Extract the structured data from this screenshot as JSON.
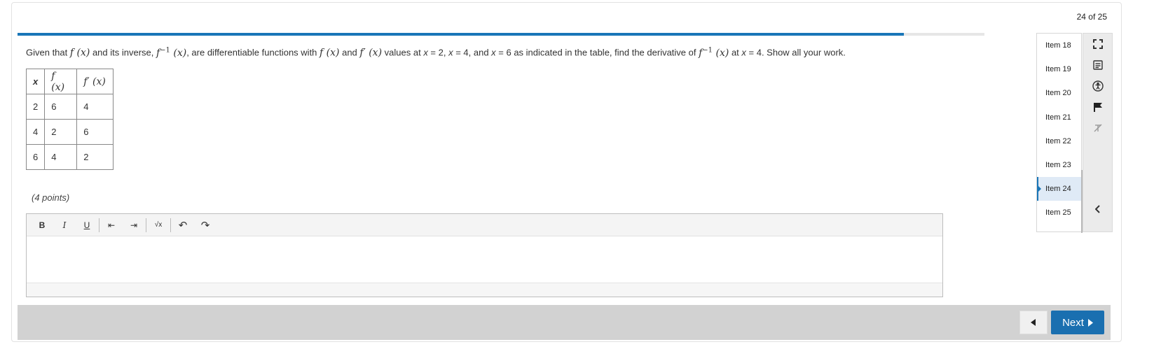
{
  "counter": "24 of 25",
  "progress": {
    "fraction": 0.917
  },
  "question": {
    "t1": "Given that ",
    "f": "f (x)",
    "t2": " and its inverse, ",
    "finv_base": "f",
    "finv_sup": "−1",
    "finv_arg": " (x)",
    "t3": ", are differentiable functions with ",
    "f2": "f (x)",
    "t4": " and ",
    "fp": "f′ (x)",
    "t5": " values at ",
    "x1": "x",
    "t6": " = 2, ",
    "x2": "x",
    "t7": " = 4, and ",
    "x3": "x",
    "t8": " = 6 as indicated in the table, find the derivative of ",
    "finv2_base": "f",
    "finv2_sup": "−1",
    "finv2_arg": " (x)",
    "t9": " at ",
    "x4": "x",
    "t10": " = 4. Show all your work."
  },
  "table": {
    "headers": [
      "x",
      "f (x)",
      "f′ (x)"
    ],
    "rows": [
      [
        "2",
        "6",
        "4"
      ],
      [
        "4",
        "2",
        "6"
      ],
      [
        "6",
        "4",
        "2"
      ]
    ]
  },
  "points": "(4 points)",
  "toolbar": {
    "bold": "B",
    "italic": "I",
    "underline": "U",
    "outdent": "⇤",
    "indent": "⇥",
    "sqrt": "√x",
    "undo": "↶",
    "redo": "↷"
  },
  "items": [
    "Item 18",
    "Item 19",
    "Item 20",
    "Item 21",
    "Item 22",
    "Item 23",
    "Item 24",
    "Item 25"
  ],
  "active_item": "Item 24",
  "nav": {
    "next_label": "Next"
  },
  "icons": [
    "fullscreen-icon",
    "notes-icon",
    "accessibility-icon",
    "flag-icon",
    "strikethrough-icon",
    "collapse-chevron-icon"
  ],
  "colors": {
    "accent": "#1a76b8",
    "next_button": "#1a6fb0",
    "footer": "#d2d2d2"
  }
}
